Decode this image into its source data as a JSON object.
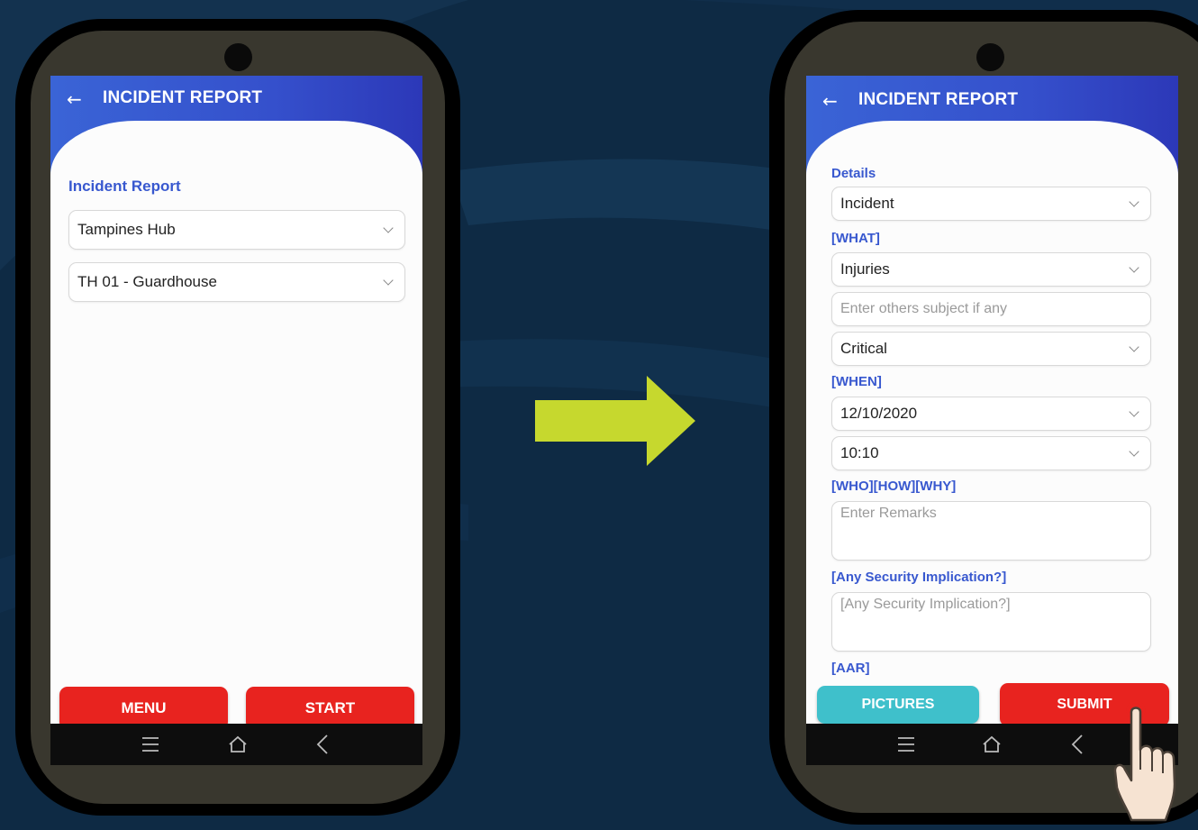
{
  "left_phone": {
    "header": {
      "back_icon": "arrow-left-icon",
      "title": "INCIDENT REPORT"
    },
    "section_label": "Incident Report",
    "site_select": "Tampines Hub",
    "location_select": "TH 01 - Guardhouse",
    "menu_label": "MENU",
    "start_label": "START"
  },
  "right_phone": {
    "header": {
      "back_icon": "arrow-left-icon",
      "title": "INCIDENT REPORT"
    },
    "details_label": "Details",
    "type_select": "Incident",
    "what_label": "[WHAT]",
    "what_select": "Injuries",
    "others_placeholder": "Enter others subject if any",
    "severity_select": "Critical",
    "when_label": "[WHEN]",
    "date_select": "12/10/2020",
    "time_select": "10:10",
    "who_how_why_label": "[WHO][HOW][WHY]",
    "remarks_placeholder": "Enter Remarks",
    "security_label": "[Any Security Implication?]",
    "security_placeholder": "[Any Security Implication?]",
    "aar_label": "[AAR]",
    "pictures_label": "PICTURES",
    "submit_label": "SUBMIT"
  },
  "navbar_icons": [
    "menu-icon",
    "home-icon",
    "back-chevron-icon"
  ],
  "transition_arrow_icon": "right-arrow-icon",
  "tap_hand_icon": "pointing-hand-icon",
  "colors": {
    "background": "#0e2a44",
    "header_start": "#3a64d6",
    "header_end": "#2c38b8",
    "accent_text": "#3858cf",
    "button_red": "#e8231f",
    "button_teal": "#3fc0cb",
    "arrow": "#c6d82e"
  }
}
